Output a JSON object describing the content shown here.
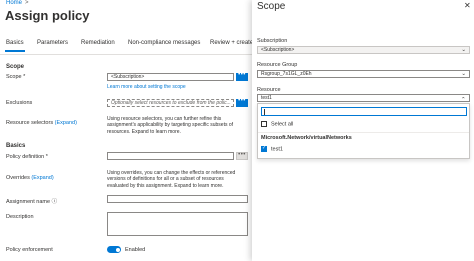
{
  "breadcrumb": {
    "home": "Home",
    "separator": ">"
  },
  "page": {
    "title": "Assign policy"
  },
  "tabs": [
    {
      "label": "Basics",
      "active": true
    },
    {
      "label": "Parameters"
    },
    {
      "label": "Remediation"
    },
    {
      "label": "Non-compliance messages"
    },
    {
      "label": "Review + create"
    }
  ],
  "scope_section": {
    "heading": "Scope",
    "scope_label": "Scope",
    "required_mark": "*",
    "scope_value": "<Subscription>",
    "browse_button": "•••",
    "learn_more": "Learn more about setting the scope",
    "exclusions_label": "Exclusions",
    "exclusions_placeholder": "Optionally select resources to exclude from the polic...",
    "resource_selectors_label": "Resource selectors",
    "resource_selectors_expand": "(Expand)",
    "resource_selectors_desc": "Using resource selectors, you can further refine this assignment's applicability by targeting specific subsets of resources. Expand to learn more."
  },
  "basics_section": {
    "heading": "Basics",
    "policy_definition_label": "Policy definition",
    "required_mark": "*",
    "policy_definition_value": "",
    "overrides_label": "Overrides",
    "overrides_expand": "(Expand)",
    "overrides_desc": "Using overrides, you can change the effects or referenced versions of definitions for all or a subset of resources evaluated by this assignment. Expand to learn more.",
    "assignment_name_label": "Assignment name",
    "assignment_name_info": "ⓘ",
    "description_label": "Description",
    "policy_enforcement_label": "Policy enforcement",
    "policy_enforcement_value": "Enabled"
  },
  "scope_panel": {
    "title": "Scope",
    "close_icon": "✕",
    "subscription_label": "Subscription",
    "subscription_value": "<Subscription>",
    "resource_group_label": "Resource Group",
    "resource_group_value": "Rsgroup_7s1GL_z0Eh",
    "resource_label": "Resource",
    "resource_value": "test1",
    "chevron": "⌄",
    "dropdown": {
      "filter_value": "",
      "select_all_label": "Select all",
      "select_all_checked": false,
      "group_label": "Microsoft.Network/virtualNetworks",
      "items": [
        {
          "label": "test1",
          "checked": true
        }
      ]
    }
  },
  "colors": {
    "accent": "#0078d4",
    "text": "#323130",
    "border": "#8a8886"
  }
}
